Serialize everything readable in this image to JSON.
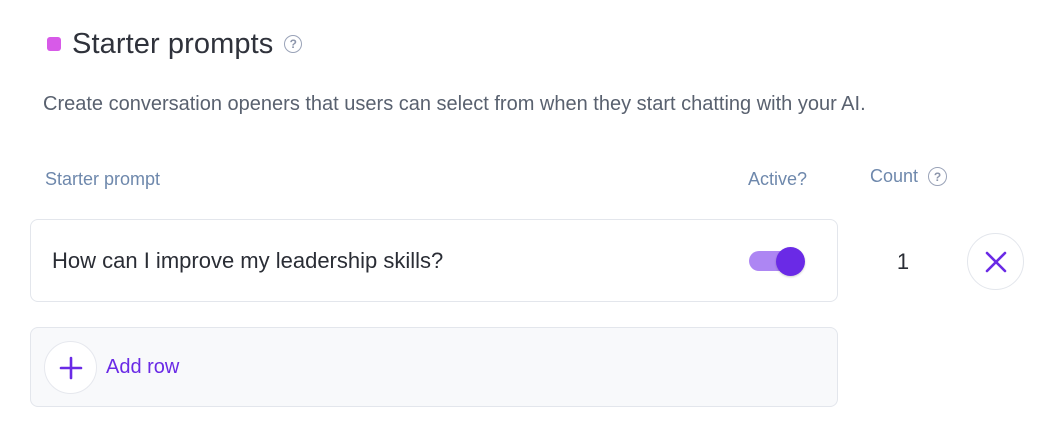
{
  "section": {
    "title": "Starter prompts",
    "help_icon": "question-circle-icon",
    "accent_color": "#d75ae8",
    "description": "Create conversation openers that users can select from when they start chatting with your AI."
  },
  "table": {
    "columns": {
      "prompt": "Starter prompt",
      "active": "Active?",
      "count": "Count"
    },
    "rows": [
      {
        "prompt": "How can I improve my leadership skills?",
        "active": true,
        "count": "1",
        "delete_icon": "close-icon"
      }
    ]
  },
  "add_row": {
    "label": "Add row",
    "icon": "plus-icon"
  },
  "colors": {
    "primary": "#6a2ae6",
    "toggle_track": "#ad86f3",
    "header_text": "#6e88ac"
  }
}
